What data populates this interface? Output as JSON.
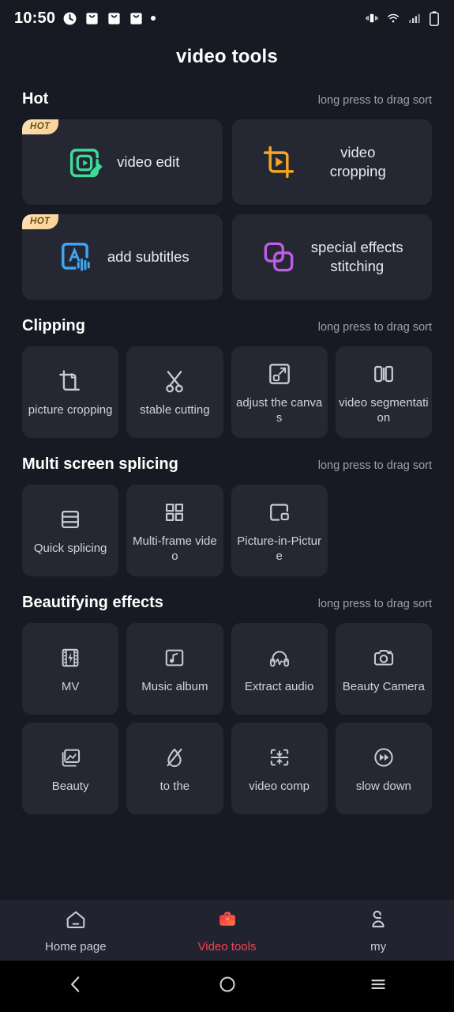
{
  "status_bar": {
    "time": "10:50",
    "left_icons": [
      "clock-icon",
      "mail-icon",
      "mail-icon",
      "mail-icon",
      "dot-indicator"
    ],
    "right_icons": [
      "vibrate-icon",
      "wifi-icon",
      "signal-icon",
      "battery-icon"
    ]
  },
  "header": {
    "title": "video tools"
  },
  "colors": {
    "page_bg": "#171a22",
    "card_bg": "#252833",
    "accent_red": "#f5414f",
    "badge_bg": "#f8cf93",
    "icon_green": "#3ddc97",
    "icon_orange": "#f5a623",
    "icon_blue": "#3da5f4",
    "icon_purple": "#c05ce8",
    "icon_gray": "#c5cbd4"
  },
  "drag_hint": "long press to drag sort",
  "sections": [
    {
      "title": "Hot",
      "hint": "long press to drag sort",
      "layout": "hot",
      "items": [
        {
          "label": "video edit",
          "icon": "video-edit-icon",
          "badge": "HOT"
        },
        {
          "label": "video cropping",
          "icon": "video-cropping-icon",
          "badge": ""
        },
        {
          "label": "add subtitles",
          "icon": "add-subtitles-icon",
          "badge": "HOT"
        },
        {
          "label": "special effects stitching",
          "icon": "effects-stitching-icon",
          "badge": ""
        }
      ]
    },
    {
      "title": "Clipping",
      "hint": "long press to drag sort",
      "layout": "grid4",
      "items": [
        {
          "label": "picture cropping",
          "icon": "crop-icon"
        },
        {
          "label": "stable cutting",
          "icon": "scissors-icon"
        },
        {
          "label": "adjust the canvas",
          "icon": "resize-canvas-icon"
        },
        {
          "label": "video segmentation",
          "icon": "split-bars-icon"
        }
      ]
    },
    {
      "title": "Multi screen splicing",
      "hint": "long press to drag sort",
      "layout": "grid3",
      "items": [
        {
          "label": "Quick splicing",
          "icon": "stacked-rows-icon"
        },
        {
          "label": "Multi-frame video",
          "icon": "four-quadrants-icon"
        },
        {
          "label": "Picture-in-Picture",
          "icon": "picture-in-picture-icon"
        }
      ]
    },
    {
      "title": "Beautifying effects",
      "hint": "long press to drag sort",
      "layout": "grid4",
      "items": [
        {
          "label": "MV",
          "icon": "film-bolt-icon"
        },
        {
          "label": "Music album",
          "icon": "music-note-frame-icon"
        },
        {
          "label": "Extract audio",
          "icon": "headphones-wave-icon"
        },
        {
          "label": "Beauty Camera",
          "icon": "camera-icon"
        },
        {
          "label": "Beauty",
          "icon": "photo-stack-icon"
        },
        {
          "label": "to the",
          "icon": "no-watermark-icon"
        },
        {
          "label": "video comp",
          "icon": "compress-icon"
        },
        {
          "label": "slow down",
          "icon": "fast-forward-icon"
        }
      ]
    }
  ],
  "bottom_nav": {
    "items": [
      {
        "label": "Home page",
        "icon": "home-icon",
        "active": false
      },
      {
        "label": "Video tools",
        "icon": "toolbox-icon",
        "active": true
      },
      {
        "label": "my",
        "icon": "person-icon",
        "active": false
      }
    ]
  },
  "system_nav": {
    "items": [
      {
        "name": "back-button",
        "icon": "chevron-left-icon"
      },
      {
        "name": "home-button",
        "icon": "circle-icon"
      },
      {
        "name": "recents-button",
        "icon": "hamburger-icon"
      }
    ]
  }
}
